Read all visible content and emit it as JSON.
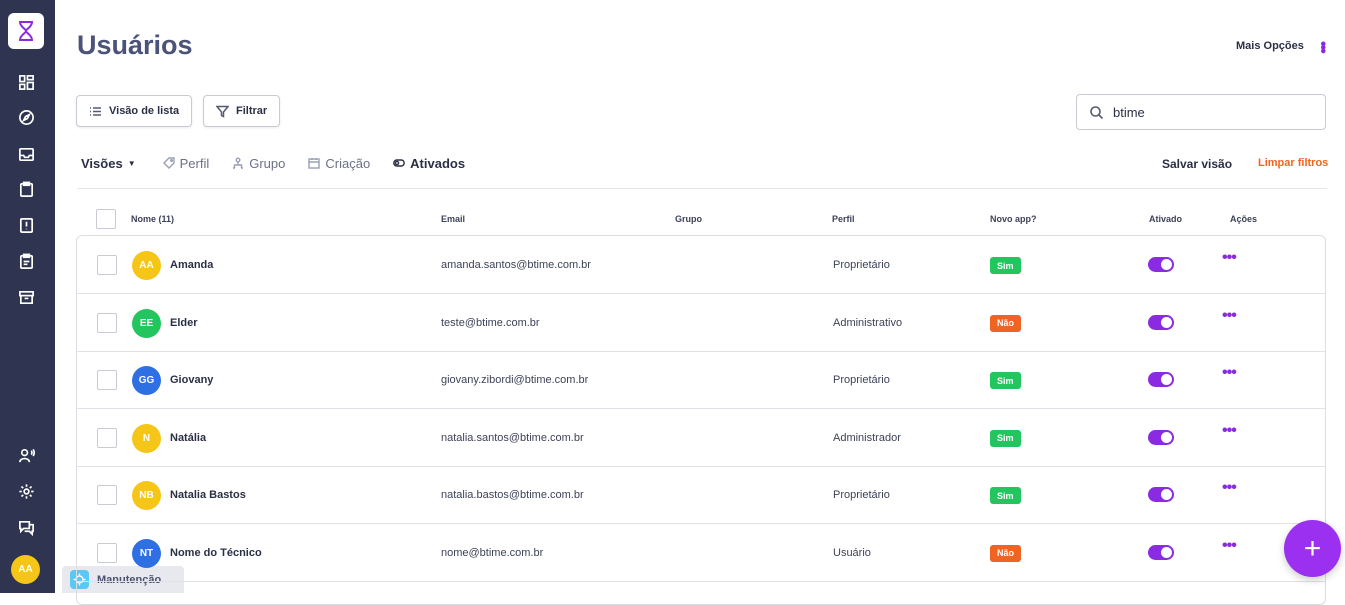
{
  "sidebar": {
    "icons": [
      "dashboard-icon",
      "compass-icon",
      "inbox-icon",
      "clipboard-icon",
      "alert-document-icon",
      "checklist-icon",
      "archive-icon",
      "user-voice-icon",
      "gear-icon",
      "chat-icon"
    ],
    "avatar_initials": "AA"
  },
  "bottom_tab": {
    "label": "Manutenção"
  },
  "header": {
    "title": "Usuários",
    "more_options": "Mais Opções"
  },
  "toolbar": {
    "list_view_label": "Visão de lista",
    "filter_label": "Filtrar"
  },
  "search": {
    "value": "btime"
  },
  "views": {
    "label": "Visões",
    "tabs": [
      {
        "label": "Perfil",
        "icon": "tag-icon",
        "active": false
      },
      {
        "label": "Grupo",
        "icon": "group-icon",
        "active": false
      },
      {
        "label": "Criação",
        "icon": "calendar-icon",
        "active": false
      },
      {
        "label": "Ativados",
        "icon": "toggle-icon",
        "active": true
      }
    ],
    "save_label": "Salvar visão",
    "clear_label": "Limpar filtros"
  },
  "table": {
    "headers": {
      "name": "Nome (11)",
      "email": "Email",
      "group": "Grupo",
      "profile": "Perfil",
      "new_app": "Novo app?",
      "active": "Ativado",
      "actions": "Ações"
    },
    "rows": [
      {
        "initials": "AA",
        "avatar_color": "#f5c518",
        "name": "Amanda",
        "email": "amanda.santos@btime.com.br",
        "group": "",
        "profile": "Proprietário",
        "new_app": "Sim",
        "active": true
      },
      {
        "initials": "EE",
        "avatar_color": "#22c55e",
        "name": "Elder",
        "email": "teste@btime.com.br",
        "group": "",
        "profile": "Administrativo",
        "new_app": "Não",
        "active": true
      },
      {
        "initials": "GG",
        "avatar_color": "#2f6fe4",
        "name": "Giovany",
        "email": "giovany.zibordi@btime.com.br",
        "group": "",
        "profile": "Proprietário",
        "new_app": "Sim",
        "active": true
      },
      {
        "initials": "N",
        "avatar_color": "#f5c518",
        "name": "Natália",
        "email": "natalia.santos@btime.com.br",
        "group": "",
        "profile": "Administrador",
        "new_app": "Sim",
        "active": true
      },
      {
        "initials": "NB",
        "avatar_color": "#f5c518",
        "name": "Natalia Bastos",
        "email": "natalia.bastos@btime.com.br",
        "group": "",
        "profile": "Proprietário",
        "new_app": "Sim",
        "active": true
      },
      {
        "initials": "NT",
        "avatar_color": "#2f6fe4",
        "name": "Nome do Técnico",
        "email": "nome@btime.com.br",
        "group": "",
        "profile": "Usuário",
        "new_app": "Não",
        "active": true
      }
    ]
  },
  "fab": {
    "label": "+"
  },
  "colors": {
    "sidebar": "#2f3550",
    "accent": "#8a2be2",
    "success": "#22c55e",
    "warning": "#f06423"
  }
}
